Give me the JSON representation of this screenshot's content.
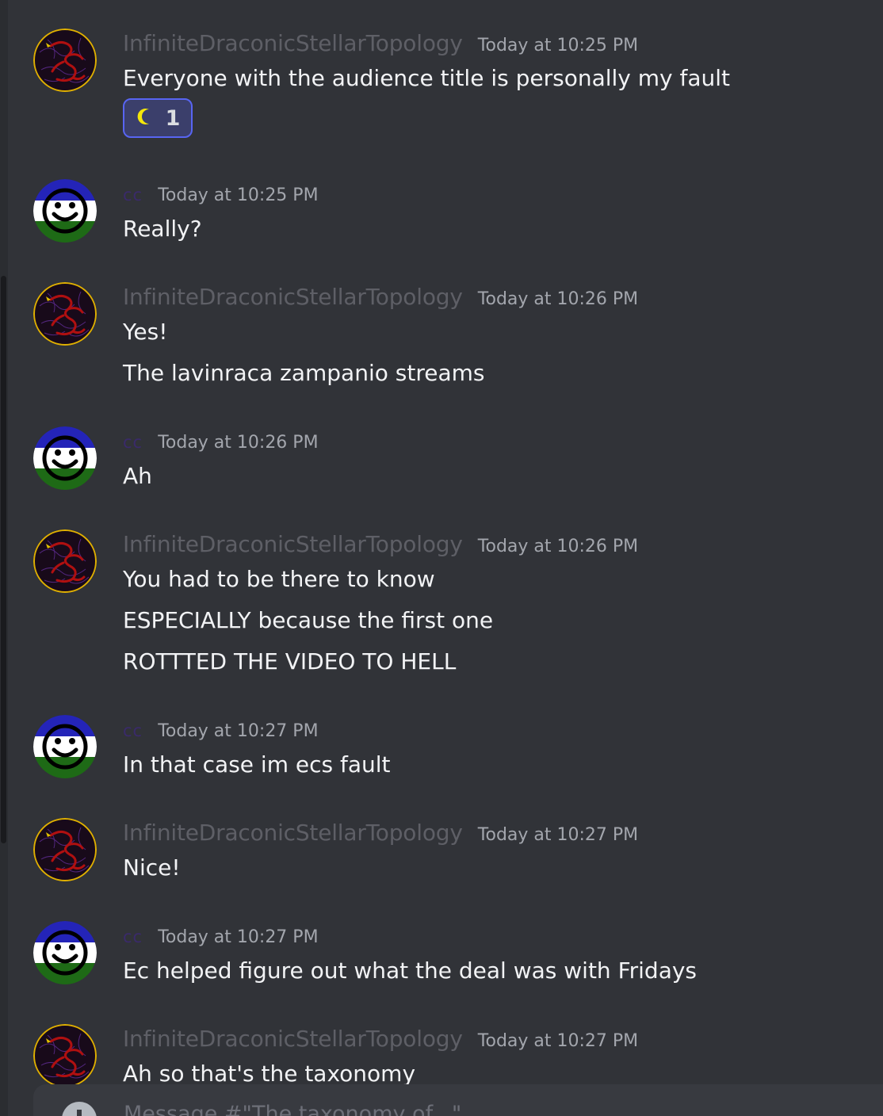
{
  "messages": [
    {
      "author": "InfiniteDraconicStellarTopology",
      "avatar": "dragon-avatar",
      "timestamp": "Today at 10:25 PM",
      "lines": [
        "Everyone with the audience title is personally my fault"
      ],
      "reaction": {
        "emoji": "crescent-moon-icon",
        "count": "1"
      }
    },
    {
      "author": "cc",
      "avatar": "smiley-avatar",
      "timestamp": "Today at 10:25 PM",
      "lines": [
        "Really?"
      ]
    },
    {
      "author": "InfiniteDraconicStellarTopology",
      "avatar": "dragon-avatar",
      "timestamp": "Today at 10:26 PM",
      "lines": [
        "Yes!",
        "The lavinraca zampanio streams"
      ]
    },
    {
      "author": "cc",
      "avatar": "smiley-avatar",
      "timestamp": "Today at 10:26 PM",
      "lines": [
        "Ah"
      ]
    },
    {
      "author": "InfiniteDraconicStellarTopology",
      "avatar": "dragon-avatar",
      "timestamp": "Today at 10:26 PM",
      "lines": [
        "You had to be there to know",
        "ESPECIALLY because the first one",
        "ROTTTED THE VIDEO TO HELL"
      ]
    },
    {
      "author": "cc",
      "avatar": "smiley-avatar",
      "timestamp": "Today at 10:27 PM",
      "lines": [
        "In that case im ecs fault"
      ]
    },
    {
      "author": "InfiniteDraconicStellarTopology",
      "avatar": "dragon-avatar",
      "timestamp": "Today at 10:27 PM",
      "lines": [
        "Nice!"
      ]
    },
    {
      "author": "cc",
      "avatar": "smiley-avatar",
      "timestamp": "Today at 10:27 PM",
      "lines": [
        "Ec helped figure out what the deal was with Fridays"
      ]
    },
    {
      "author": "InfiniteDraconicStellarTopology",
      "avatar": "dragon-avatar",
      "timestamp": "Today at 10:27 PM",
      "lines": [
        "Ah so that's the taxonomy"
      ]
    }
  ],
  "composer": {
    "add_icon": "plus-circle-icon",
    "placeholder": "Message #\"The taxonomy of...\""
  },
  "colors": {
    "background": "#313338",
    "reaction_border": "#5865f2",
    "moon": "#f5e60a",
    "cc_username": "#3a2a6a"
  }
}
